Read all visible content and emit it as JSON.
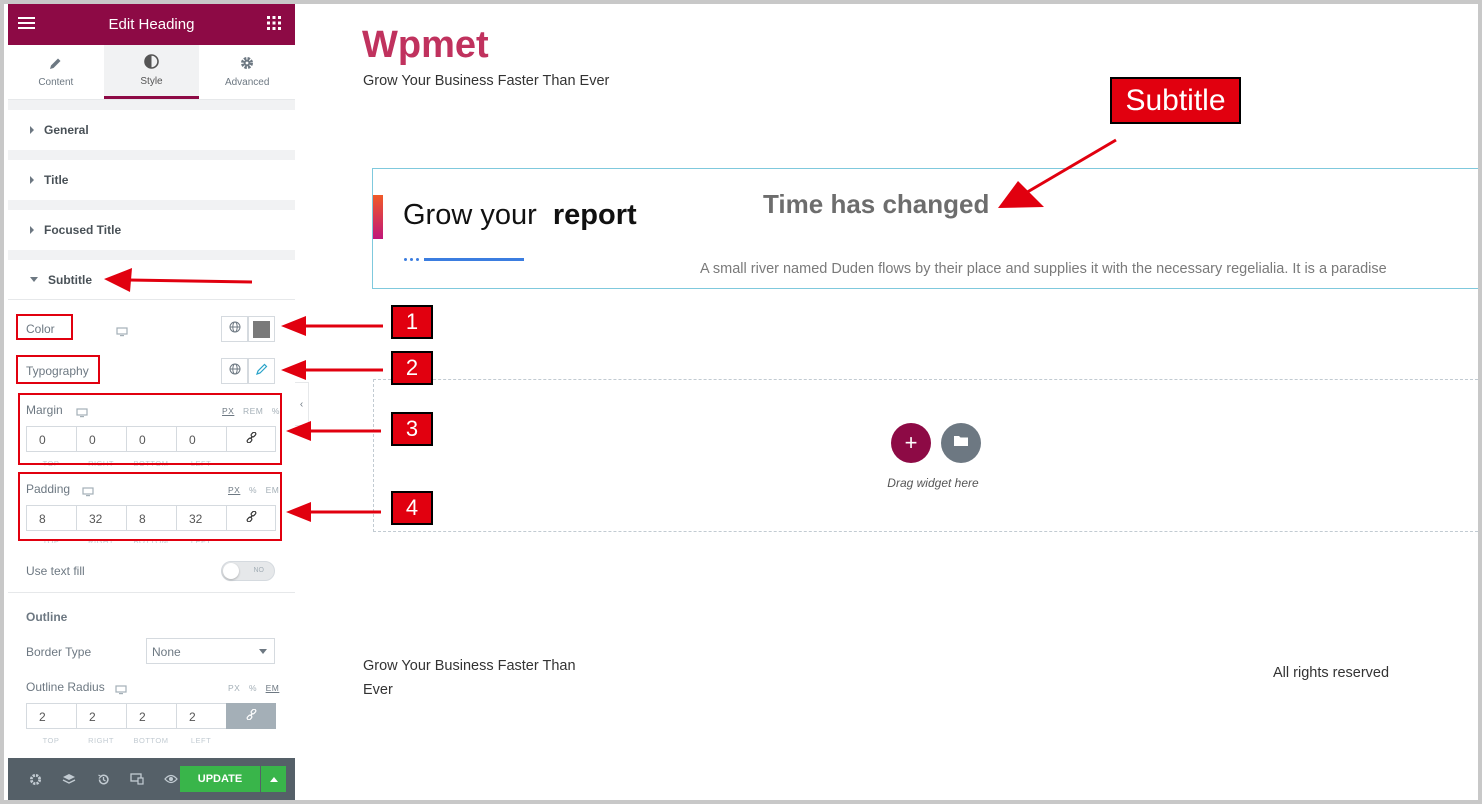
{
  "panel": {
    "title": "Edit Heading",
    "tabs": [
      {
        "label": "Content",
        "icon": "pencil-icon"
      },
      {
        "label": "Style",
        "icon": "contrast-icon"
      },
      {
        "label": "Advanced",
        "icon": "gear-icon"
      }
    ],
    "sections": [
      "General",
      "Title",
      "Focused Title",
      "Subtitle"
    ],
    "subtitle": {
      "color_label": "Color",
      "color_value": "#7a7a7a",
      "typography_label": "Typography",
      "margin": {
        "label": "Margin",
        "units": [
          "PX",
          "REM",
          "%"
        ],
        "values": [
          "0",
          "0",
          "0",
          "0"
        ],
        "sides": [
          "TOP",
          "RIGHT",
          "BOTTOM",
          "LEFT"
        ]
      },
      "padding": {
        "label": "Padding",
        "units": [
          "PX",
          "%",
          "EM"
        ],
        "values": [
          "8",
          "32",
          "8",
          "32"
        ],
        "sides": [
          "TOP",
          "RIGHT",
          "BOTTOM",
          "LEFT"
        ]
      },
      "text_fill_label": "Use text fill",
      "text_fill_toggle": "NO",
      "outline_heading": "Outline",
      "border_type_label": "Border Type",
      "border_type_value": "None",
      "outline_radius": {
        "label": "Outline Radius",
        "units": [
          "PX",
          "%",
          "EM"
        ],
        "values": [
          "2",
          "2",
          "2",
          "2"
        ],
        "sides": [
          "TOP",
          "RIGHT",
          "BOTTOM",
          "LEFT"
        ]
      }
    },
    "update_label": "UPDATE"
  },
  "canvas": {
    "site_title": "Wpmet",
    "site_tagline": "Grow Your Business Faster Than Ever",
    "heading_part1": "Grow your",
    "heading_part2": "report",
    "subtitle_text": "Time has changed",
    "description": "A small river named Duden flows by their place and supplies it with the necessary regelialia. It is a paradise",
    "drag_text": "Drag widget here",
    "footer_left_line1": "Grow Your Business Faster Than",
    "footer_left_line2": "Ever",
    "footer_right": "All rights reserved"
  },
  "annotations": {
    "callout": "Subtitle",
    "numbers": [
      "1",
      "2",
      "3",
      "4"
    ]
  },
  "colors": {
    "brand": "#8d0a45",
    "site_title": "#c0325e",
    "update": "#39b54a",
    "annotation_red": "#e1000f"
  }
}
